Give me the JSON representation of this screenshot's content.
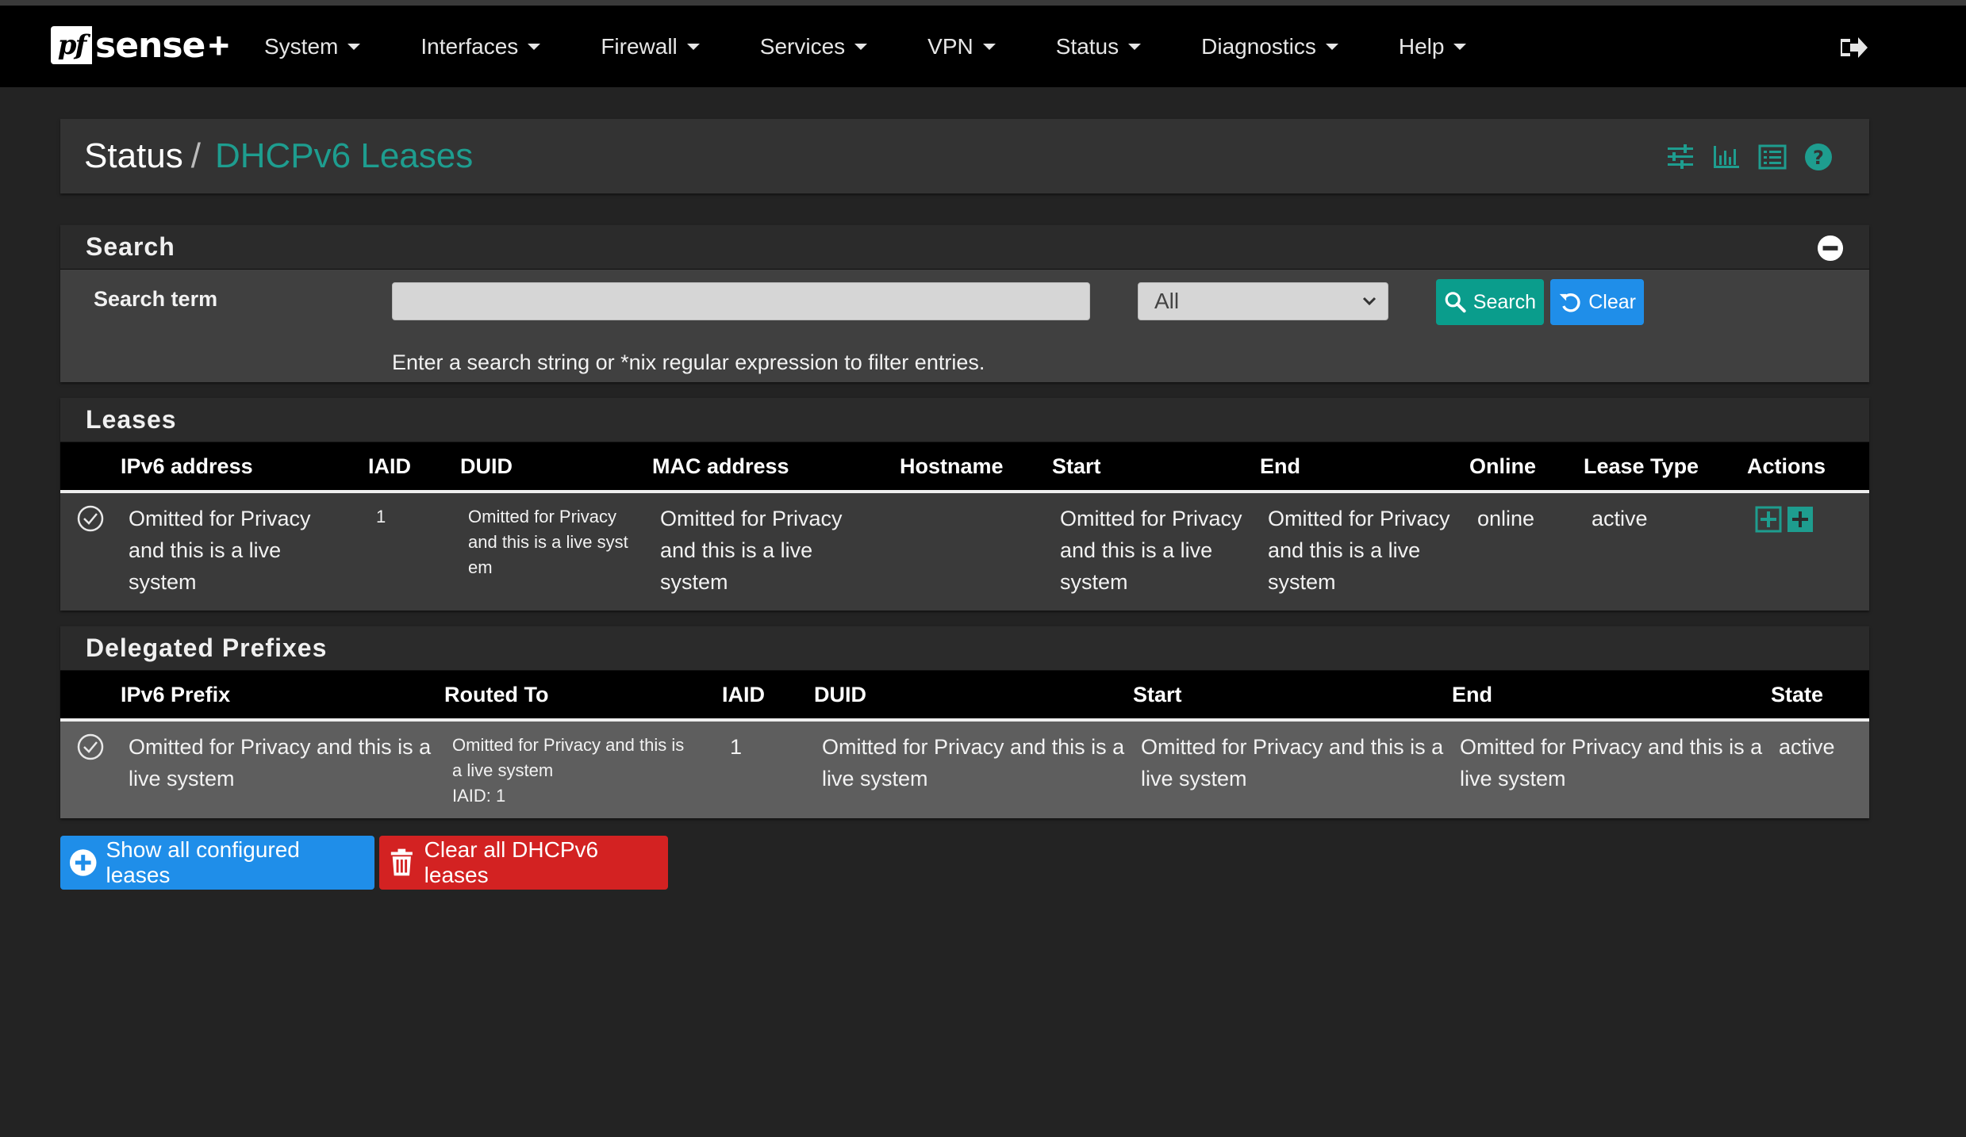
{
  "brand": {
    "logo_pf": "pf",
    "logo_sense": "sense",
    "logo_plus": "+"
  },
  "nav": {
    "items": [
      {
        "label": "System"
      },
      {
        "label": "Interfaces"
      },
      {
        "label": "Firewall"
      },
      {
        "label": "Services"
      },
      {
        "label": "VPN"
      },
      {
        "label": "Status"
      },
      {
        "label": "Diagnostics"
      },
      {
        "label": "Help"
      }
    ],
    "logout_icon": "logout-icon"
  },
  "breadcrumb": {
    "parent": "Status",
    "separator": "/",
    "current": "DHCPv6 Leases"
  },
  "search": {
    "title": "Search",
    "term_label": "Search term",
    "input_value": "",
    "select_value": "All",
    "search_button": "Search",
    "clear_button": "Clear",
    "help_text": "Enter a search string or *nix regular expression to filter entries."
  },
  "leases": {
    "title": "Leases",
    "columns": [
      "IPv6 address",
      "IAID",
      "DUID",
      "MAC address",
      "Hostname",
      "Start",
      "End",
      "Online",
      "Lease Type",
      "Actions"
    ],
    "rows": [
      {
        "ipv6": "Omitted for Privacy and this is a live system",
        "iaid": "1",
        "duid_line1": "Omitted for Privacy",
        "duid_line2": "and this is a live syst",
        "duid_line3": "em",
        "mac": "Omitted for Privacy and this is a live system",
        "hostname": "",
        "start": "Omitted for Privacy and this is a live system",
        "end": "Omitted for Privacy and this is a live system",
        "online": "online",
        "lease_type": "active"
      }
    ]
  },
  "prefixes": {
    "title": "Delegated Prefixes",
    "columns": [
      "IPv6 Prefix",
      "Routed To",
      "IAID",
      "DUID",
      "Start",
      "End",
      "State"
    ],
    "rows": [
      {
        "prefix": "Omitted for Privacy and this is a live system",
        "routed_line1": "Omitted for Privacy and this is",
        "routed_line2": "a live system",
        "routed_line3": "IAID: 1",
        "iaid": "1",
        "duid": "Omitted for Privacy and this is a live system",
        "start": "Omitted for Privacy and this is a live system",
        "end": "Omitted for Privacy and this is a live system",
        "state": "active"
      }
    ]
  },
  "actions": {
    "show_all": "Show all configured leases",
    "clear_all": "Clear all DHCPv6 leases"
  },
  "colors": {
    "accent": "#1e9d8f",
    "primary": "#1f8ee9",
    "danger": "#d32222",
    "success": "#0a9d8c"
  }
}
